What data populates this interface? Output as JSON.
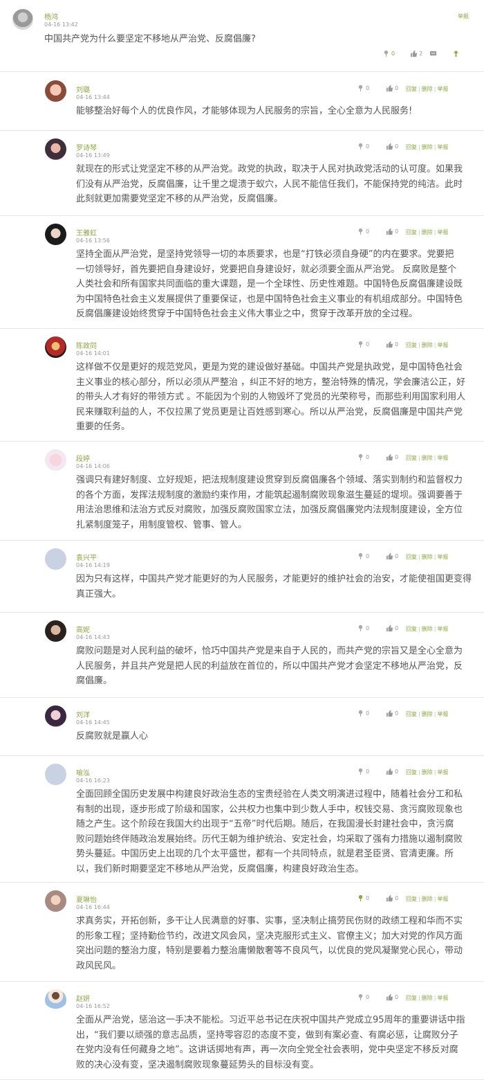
{
  "post": {
    "author": "杨鸿",
    "time": "04-16 13:42",
    "report_label": "举报",
    "question": "中国共产党为什么要坚定不移地从严治党、反腐倡廉?",
    "flower_count": "0",
    "like_count": "2"
  },
  "comment_actions": {
    "reply": "回复",
    "delete": "删除",
    "report": "举报",
    "sep": "|"
  },
  "comments": [
    {
      "name": "刘璐",
      "time": "04-16 13:44",
      "flower": "0",
      "like": "0",
      "lines": [
        "能够整治好每个人的优良作风，才能够体现为人民服务的宗旨，全心全意为人民服务!"
      ]
    },
    {
      "name": "罗诗琴",
      "time": "04-16 13:49",
      "flower": "0",
      "like": "0",
      "lines": [
        "就现在的形式让党坚定不移的从严治党。政党的执政，取决于人民对执政党活动的认可度。如果我",
        "们没有从严治党，反腐倡廉，让千里之堤溃于蚁穴，人民不能信任我们，不能保持党的纯洁。此时",
        "此刻就更加需要党坚定不移的从严治党，反腐倡廉。"
      ]
    },
    {
      "name": "王雅虹",
      "time": "04-16 13:56",
      "flower": "0",
      "like": "0",
      "lines": [
        "坚持全面从严治党，是坚持党领导一切的本质要求，也是“打铁必须自身硬”的内在要求。党要把",
        "一切领导好，首先要把自身建设好，党要把自身建设好，就必须要全面从严治党。   反腐败是整个",
        "人类社会和所有国家共同面临的重大课题，是一个全球性、历史性难题。中国特色反腐倡廉建设既",
        "为中国特色社会主义发展提供了重要保证，也是中国特色社会主义事业的有机组成部分。中国特色",
        "反腐倡廉建设始终贯穿于中国特色社会主义伟大事业之中，贯穿于改革开放的全过程。"
      ]
    },
    {
      "name": "陈政同",
      "time": "04-16 14:01",
      "flower": "0",
      "like": "0",
      "lines": [
        "这样做不仅是更好的规范党风，更是为党的建设做好基础。中国共产党是执政党，是中国特色社会",
        "主义事业的核心部分，所以必须从严整治 ，纠正不好的地方，整治特殊的情况，学会廉洁公正，好",
        "的带头人才有好的带领方式 。不能因为个别的人物毁坏了党员的光荣称号，而那些利用国家利用人",
        "民来赚取利益的人，不仅拉黑了党员更是让百姓感到寒心。所以从严治党，反腐倡廉是中国共产党",
        "重要的任务。"
      ]
    },
    {
      "name": "段婷",
      "time": "04-16 14:06",
      "flower": "0",
      "like": "0",
      "lines": [
        "强调只有建好制度、立好规矩，把法规制度建设贯穿到反腐倡廉各个领域、落实到制约和监督权力",
        "的各个方面，发挥法规制度的激励约束作用，才能筑起遏制腐败现象滋生蔓延的堤坝。强调要善于",
        "用法治思维和法治方式反对腐败，加强反腐败国家立法，加强反腐倡廉党内法规制度建设，全方位",
        "扎紧制度笼子，用制度管权、管事、管人。"
      ]
    },
    {
      "name": "袁兴平",
      "time": "04-16 14:19",
      "flower": "0",
      "like": "0",
      "lines": [
        "因为只有这样，中国共产党才能更好的为人民服务，才能更好的维护社会的治安，才能使祖国更变得",
        "真正强大。"
      ]
    },
    {
      "name": "高妮",
      "time": "04-16 14:43",
      "flower": "0",
      "like": "0",
      "lines": [
        "腐败问题是对人民利益的破坏，恰巧中国共产党是来自于人民的，而共产党的宗旨又是全心全意为",
        "人民服务，并且共产党是把人民的利益放在首位的，所以中国共产党才会坚定不移地从严治党，反",
        "腐倡廉。"
      ]
    },
    {
      "name": "刘洋",
      "time": "04-16 14:45",
      "flower": "0",
      "like": "0",
      "lines": [
        "反腐败就是赢人心"
      ]
    },
    {
      "name": "喻泓",
      "time": "04-16 16:23",
      "flower": "0",
      "like": "0",
      "lines": [
        "全面回顾全国历史发展中构建良好政治生态的宝贵经验在人类文明演进过程中，随着社会分工和私",
        "有制的出现，逐步形成了阶级和国家，公共权力也集中到少数人手中，权钱交易、贪污腐败现象也",
        "随之产生。这个阶段在我国大约出现于“五帝”时代后期。随后，在我国漫长封建社会中，贪污腐",
        "败问题始终伴随政治发展始终。历代王朝为维护统治、安定社会，均采取了强有力措施以遏制腐败",
        "势头蔓延。中国历史上出现的几个太平盛世，都有一个共同特点，就是君圣臣贤、官清吏廉。所",
        "以，我们新时期要坚定不移地从严治党，反腐倡廉，构建良好政治生态。"
      ]
    },
    {
      "name": "夏琳怡",
      "time": "04-16 16:44",
      "flower": "0",
      "like": "0",
      "lines": [
        "求真务实，开拓创新，多干让人民满意的好事、实事，坚决制止搞劳民伤财的政绩工程和华而不实",
        "的形象工程；坚持勤俭节约，改进文风会风，坚决克服形式主义、官僚主义；加大对党的作风方面",
        "突出问题的整治力度，特别是要着力整治庸懒散奢等不良风气，以优良的党风凝聚党心民心，带动",
        "政风民风。"
      ]
    },
    {
      "name": "赵妍",
      "time": "04-16 16:52",
      "flower": "0",
      "like": "0",
      "lines": [
        "全面从严治党，惩治这一手决不能松。习近平总书记在庆祝中国共产党成立95周年的重要讲话中指",
        "出，“我们要以顽强的意志品质，坚持零容忍的态度不变，做到有案必查、有腐必惩，让腐败分子",
        "在党内没有任何藏身之地”。这讲话掷地有声，再一次向全党全社会表明，党中央坚定不移反对腐",
        "败的决心没有变，坚决遏制腐败现象蔓延势头的目标没有变。"
      ]
    }
  ]
}
